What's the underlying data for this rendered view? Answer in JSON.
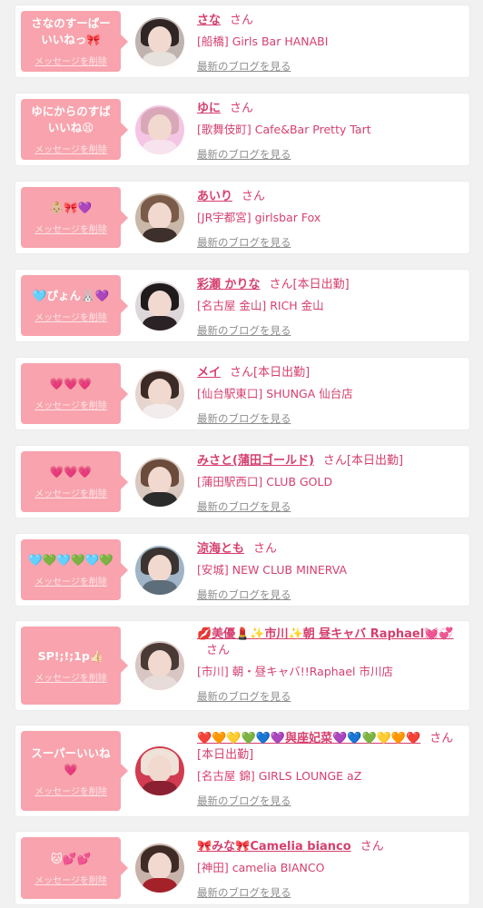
{
  "colors": {
    "accent": "#d63f6e",
    "bubble": "#f8a3ad",
    "page_bg": "#f1f1f1"
  },
  "common": {
    "delete_label": "メッセージを削除",
    "blog_label": "最新のブログを見る",
    "san": "さん"
  },
  "items": [
    {
      "message": "さなのすーぱーいいねっ🎀",
      "name": "さな",
      "status": "",
      "shop": "[船橋] Girls Bar HANABI"
    },
    {
      "message": "ゆにからのすばいいね😫",
      "name": "ゆに",
      "status": "",
      "shop": "[歌舞伎町] Cafe&Bar Pretty Tart"
    },
    {
      "message": "👶🏼🎀💜",
      "name": "あいり",
      "status": "",
      "shop": "[JR宇都宮] girlsbar Fox"
    },
    {
      "message": "🩵ぴょん🐰💜",
      "name": "彩瀬 かりな",
      "status": "[本日出勤]",
      "shop": "[名古屋 金山] RICH 金山"
    },
    {
      "message": "💗💗💗",
      "name": "メイ",
      "status": "[本日出勤]",
      "shop": "[仙台駅東口] SHUNGA 仙台店"
    },
    {
      "message": "💗💗💗",
      "name": "みさと(蒲田ゴールド)",
      "status": "[本日出勤]",
      "shop": "[蒲田駅西口] CLUB GOLD"
    },
    {
      "message": "🩵💚🩵💚🩵💚",
      "name": "涼海とも",
      "status": "",
      "shop": "[安城] NEW CLUB MINERVA"
    },
    {
      "message": "SP!;!;1p👍🏻",
      "name": "💋美優💄✨市川✨朝 昼キャバ Raphael💓💞",
      "status": "",
      "shop": "[市川] 朝・昼キャバ!!Raphael 市川店"
    },
    {
      "message": "スーパーいいね💗",
      "name": "❤️🧡💛💚💙💜與座妃菜💜💙💚💛🧡❤️",
      "status": "[本日出勤]",
      "shop": "[名古屋 錦] GIRLS LOUNGE aZ"
    },
    {
      "message": "🐱💕💕",
      "name": "🎀みな🎀Camelia bianco",
      "status": "",
      "shop": "[神田] camelia BIANCO"
    }
  ]
}
